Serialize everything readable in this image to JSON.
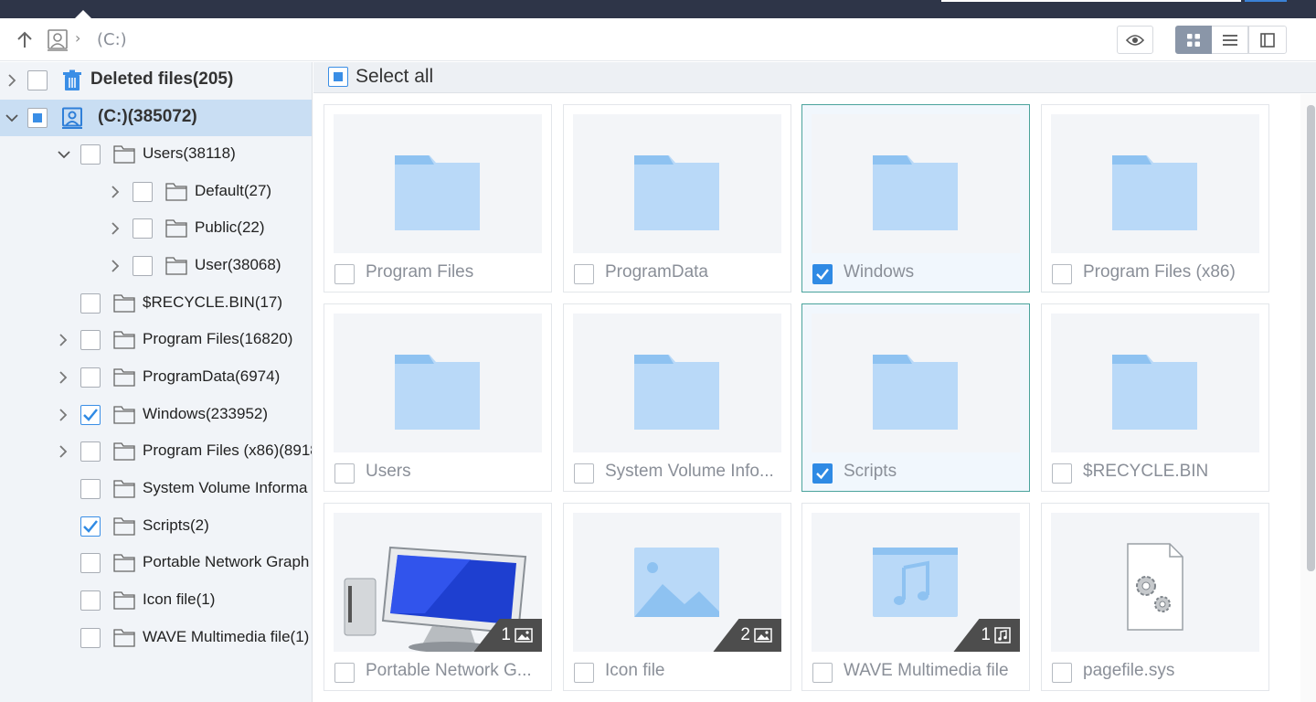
{
  "window": {
    "accent_color": "#2e3548"
  },
  "address_bar": {
    "path": "(C:)",
    "separator": "›",
    "view_modes": [
      "preview",
      "grid",
      "list",
      "detail"
    ],
    "active_view": "grid"
  },
  "sidebar": {
    "items": [
      {
        "label": "Deleted files(205)",
        "icon": "trash-icon",
        "checked": "unchecked",
        "expander": "collapsed"
      },
      {
        "label": "(C:)(385072)",
        "icon": "drive-icon",
        "checked": "partial",
        "expander": "expanded",
        "selected": true
      },
      {
        "label": "Users(38118)",
        "icon": "folder-icon",
        "checked": "unchecked",
        "expander": "expanded"
      },
      {
        "label": "Default(27)",
        "icon": "folder-icon",
        "checked": "unchecked",
        "expander": "collapsed"
      },
      {
        "label": "Public(22)",
        "icon": "folder-icon",
        "checked": "unchecked",
        "expander": "collapsed"
      },
      {
        "label": "User(38068)",
        "icon": "folder-icon",
        "checked": "unchecked",
        "expander": "collapsed"
      },
      {
        "label": "$RECYCLE.BIN(17)",
        "icon": "folder-icon",
        "checked": "unchecked",
        "expander": "none"
      },
      {
        "label": "Program Files(16820)",
        "icon": "folder-icon",
        "checked": "unchecked",
        "expander": "collapsed"
      },
      {
        "label": "ProgramData(6974)",
        "icon": "folder-icon",
        "checked": "unchecked",
        "expander": "collapsed"
      },
      {
        "label": "Windows(233952)",
        "icon": "folder-icon",
        "checked": "checked",
        "expander": "collapsed"
      },
      {
        "label": "Program Files (x86)(8918",
        "icon": "folder-icon",
        "checked": "unchecked",
        "expander": "collapsed"
      },
      {
        "label": "System Volume Informa",
        "icon": "folder-icon",
        "checked": "unchecked",
        "expander": "none"
      },
      {
        "label": "Scripts(2)",
        "icon": "folder-icon",
        "checked": "checked",
        "expander": "none"
      },
      {
        "label": "Portable Network Graph",
        "icon": "folder-icon",
        "checked": "unchecked",
        "expander": "none"
      },
      {
        "label": "Icon file(1)",
        "icon": "folder-icon",
        "checked": "unchecked",
        "expander": "none"
      },
      {
        "label": "WAVE Multimedia file(1)",
        "icon": "folder-icon",
        "checked": "unchecked",
        "expander": "none"
      }
    ]
  },
  "main": {
    "select_all_label": "Select all",
    "select_all_state": "partial",
    "tiles": [
      {
        "name": "Program Files",
        "kind": "folder-icon",
        "checked": false
      },
      {
        "name": "ProgramData",
        "kind": "folder-icon",
        "checked": false
      },
      {
        "name": "Windows",
        "kind": "folder-icon",
        "checked": true
      },
      {
        "name": "Program Files (x86)",
        "kind": "folder-icon",
        "checked": false
      },
      {
        "name": "Users",
        "kind": "folder-icon",
        "checked": false
      },
      {
        "name": "System Volume Info...",
        "kind": "folder-icon",
        "checked": false
      },
      {
        "name": "Scripts",
        "kind": "folder-icon",
        "checked": true
      },
      {
        "name": "$RECYCLE.BIN",
        "kind": "folder-icon",
        "checked": false
      },
      {
        "name": "Portable Network G...",
        "kind": "computer-icon",
        "checked": false,
        "badge": "1",
        "badge_icon": "image-icon"
      },
      {
        "name": "Icon file",
        "kind": "image-folder-icon",
        "checked": false,
        "badge": "2",
        "badge_icon": "image-icon"
      },
      {
        "name": "WAVE Multimedia file",
        "kind": "music-folder-icon",
        "checked": false,
        "badge": "1",
        "badge_icon": "music-icon"
      },
      {
        "name": "pagefile.sys",
        "kind": "settings-file-icon",
        "checked": false
      }
    ]
  }
}
